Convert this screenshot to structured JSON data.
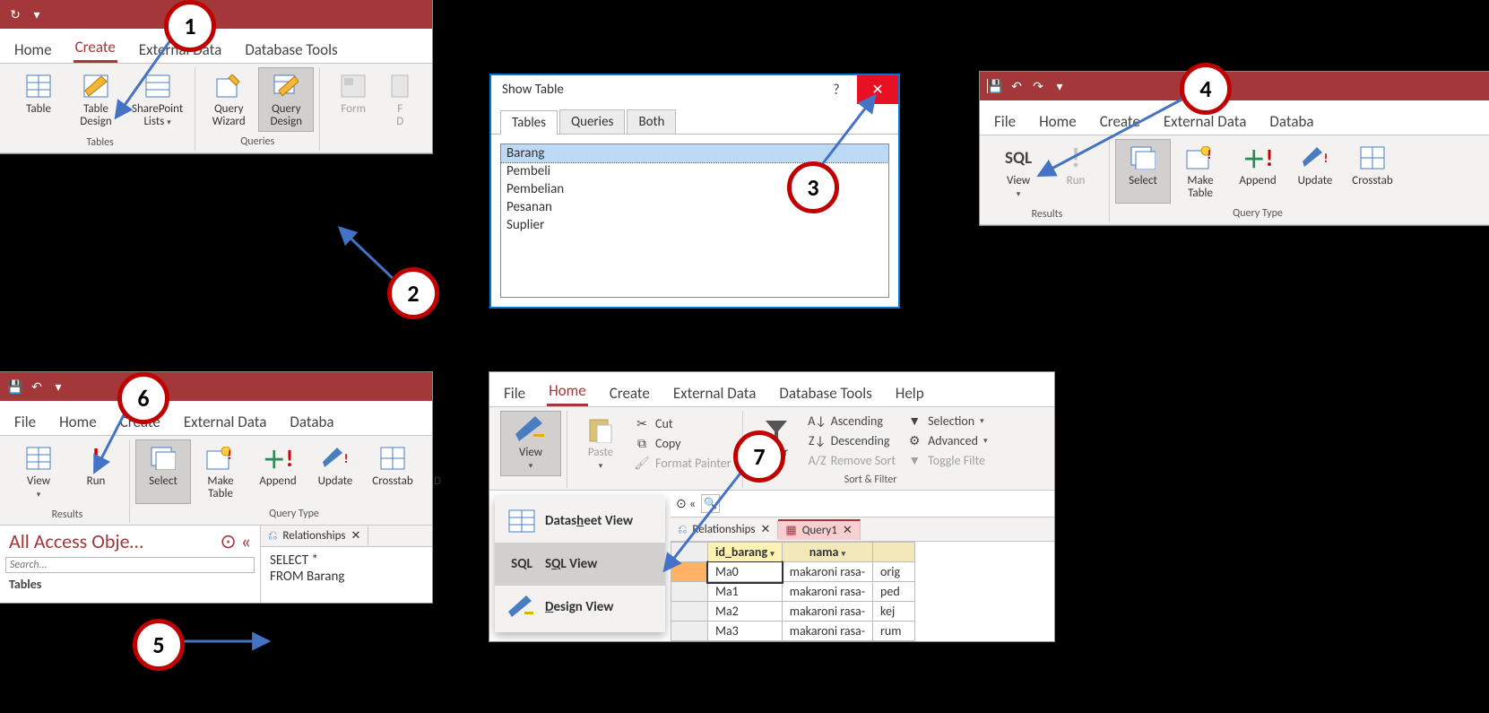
{
  "panel1": {
    "tabs": [
      "Home",
      "Create",
      "External Data",
      "Database Tools"
    ],
    "active_tab": "Create",
    "tables_group": "Tables",
    "queries_group": "Queries",
    "btn_table": "Table",
    "btn_table_design": "Table\nDesign",
    "btn_sharepoint": "SharePoint\nLists",
    "btn_query_wizard": "Query\nWizard",
    "btn_query_design": "Query\nDesign",
    "btn_form": "Form",
    "btn_form2": "F\nD"
  },
  "dialog": {
    "title": "Show Table",
    "tabs": [
      "Tables",
      "Queries",
      "Both"
    ],
    "active": "Tables",
    "items": [
      "Barang",
      "Pembeli",
      "Pembelian",
      "Pesanan",
      "Suplier"
    ],
    "selected": "Barang"
  },
  "panel4": {
    "tabs": [
      "File",
      "Home",
      "Create",
      "External Data",
      "Databa"
    ],
    "active_tab": "Create",
    "results_group": "Results",
    "query_type_group": "Query Type",
    "btn_view": "View",
    "btn_run": "Run",
    "btn_select": "Select",
    "btn_make_table": "Make\nTable",
    "btn_append": "Append",
    "btn_update": "Update",
    "btn_crosstab": "Crosstab",
    "sql_text": "SQL"
  },
  "panel6": {
    "tabs": [
      "File",
      "Home",
      "Create",
      "External Data",
      "Databa"
    ],
    "active_tab": "Home",
    "results_group": "Results",
    "query_type_group": "Query Type",
    "btn_view": "View",
    "btn_run": "Run",
    "btn_select": "Select",
    "btn_make_table": "Make\nTable",
    "btn_append": "Append",
    "btn_update": "Update",
    "btn_crosstab": "Crosstab",
    "btn_last": "D",
    "nav_title": "All Access Obje…",
    "nav_search": "Search...",
    "nav_tables": "Tables",
    "doc_tab_rel": "Relationships",
    "sql": "SELECT *\nFROM Barang"
  },
  "panel7": {
    "tabs": [
      "File",
      "Home",
      "Create",
      "External Data",
      "Database Tools",
      "Help"
    ],
    "active_tab": "Home",
    "btn_view": "View",
    "btn_paste": "Paste",
    "btn_cut": "Cut",
    "btn_copy": "Copy",
    "btn_format": "Format Painter",
    "btn_filter": "Filter",
    "btn_asc": "Ascending",
    "btn_desc": "Descending",
    "btn_remove_sort": "Remove Sort",
    "btn_selection": "Selection",
    "btn_advanced": "Advanced",
    "btn_toggle": "Toggle Filte",
    "sort_group": "Sort & Filter",
    "vm_datasheet": "Datasheet View",
    "vm_sql": "SQL View",
    "vm_design": "Design View",
    "doc_tab_rel": "Relationships",
    "doc_tab_query": "Query1",
    "col_id": "id_barang",
    "col_nama": "nama",
    "rows": [
      {
        "id": "Ma0",
        "nama": "makaroni rasa-",
        "ext": "orig"
      },
      {
        "id": "Ma1",
        "nama": "makaroni rasa-",
        "ext": "ped"
      },
      {
        "id": "Ma2",
        "nama": "makaroni rasa-",
        "ext": "kej"
      },
      {
        "id": "Ma3",
        "nama": "makaroni rasa-",
        "ext": "rum"
      }
    ]
  },
  "callouts": {
    "1": "1",
    "2": "2",
    "3": "3",
    "4": "4",
    "5": "5",
    "6": "6",
    "7": "7"
  }
}
